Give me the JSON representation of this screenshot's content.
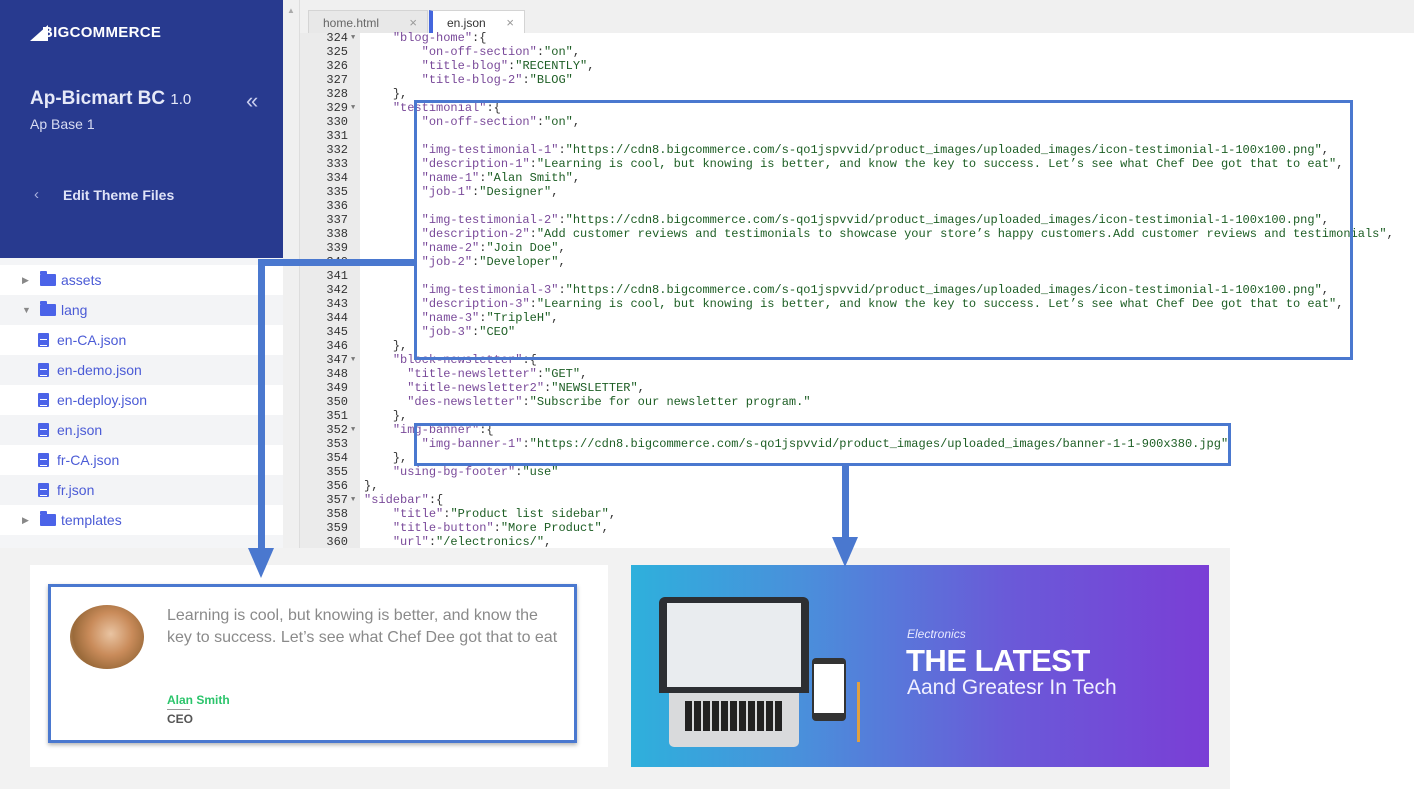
{
  "sidebar": {
    "logo": "BIGCOMMERCE",
    "theme_name": "Ap-Bicmart BC",
    "theme_version": "1.0",
    "theme_variant": "Ap Base 1",
    "collapse_icon": "«",
    "back_icon": "‹",
    "edit_label": "Edit Theme Files",
    "tree": [
      {
        "type": "folder",
        "label": "assets",
        "expanded": false
      },
      {
        "type": "folder",
        "label": "lang",
        "expanded": true
      },
      {
        "type": "file",
        "label": "en-CA.json"
      },
      {
        "type": "file",
        "label": "en-demo.json"
      },
      {
        "type": "file",
        "label": "en-deploy.json"
      },
      {
        "type": "file",
        "label": "en.json"
      },
      {
        "type": "file",
        "label": "fr-CA.json"
      },
      {
        "type": "file",
        "label": "fr.json"
      },
      {
        "type": "folder",
        "label": "templates",
        "expanded": false
      }
    ]
  },
  "editor": {
    "tabs": [
      {
        "label": "home.html",
        "active": false
      },
      {
        "label": "en.json",
        "active": true
      }
    ],
    "close_icon": "×",
    "lines": [
      {
        "n": "324",
        "i": 8,
        "k": "blog-home",
        "p": ":{",
        "f": true
      },
      {
        "n": "325",
        "i": 12,
        "k": "on-off-section",
        "v": "on",
        "p": ","
      },
      {
        "n": "326",
        "i": 12,
        "k": "title-blog",
        "v": "RECENTLY",
        "p": ","
      },
      {
        "n": "327",
        "i": 12,
        "k": "title-blog-2",
        "v": "BLOG"
      },
      {
        "n": "328",
        "i": 8,
        "p": "},"
      },
      {
        "n": "329",
        "i": 8,
        "k": "testimonial",
        "p": ":{",
        "f": true
      },
      {
        "n": "330",
        "i": 12,
        "k": "on-off-section",
        "v": "on",
        "p": ","
      },
      {
        "n": "331"
      },
      {
        "n": "332",
        "i": 12,
        "k": "img-testimonial-1",
        "v": "https://cdn8.bigcommerce.com/s-qo1jspvvid/product_images/uploaded_images/icon-testimonial-1-100x100.png",
        "p": ","
      },
      {
        "n": "333",
        "i": 12,
        "k": "description-1",
        "v": "Learning is cool, but knowing is better, and know the key to success. Let’s see what Chef Dee got that to eat",
        "p": ","
      },
      {
        "n": "334",
        "i": 12,
        "k": "name-1",
        "v": "Alan Smith",
        "p": ","
      },
      {
        "n": "335",
        "i": 12,
        "k": "job-1",
        "v": "Designer",
        "p": ","
      },
      {
        "n": "336"
      },
      {
        "n": "337",
        "i": 12,
        "k": "img-testimonial-2",
        "v": "https://cdn8.bigcommerce.com/s-qo1jspvvid/product_images/uploaded_images/icon-testimonial-1-100x100.png",
        "p": ","
      },
      {
        "n": "338",
        "i": 12,
        "k": "description-2",
        "v": "Add customer reviews and testimonials to showcase your store’s happy customers.Add customer reviews and testimonials",
        "p": ","
      },
      {
        "n": "339",
        "i": 12,
        "k": "name-2",
        "v": "Join Doe",
        "p": ","
      },
      {
        "n": "340",
        "i": 12,
        "k": "job-2",
        "v": "Developer",
        "p": ","
      },
      {
        "n": "341"
      },
      {
        "n": "342",
        "i": 12,
        "k": "img-testimonial-3",
        "v": "https://cdn8.bigcommerce.com/s-qo1jspvvid/product_images/uploaded_images/icon-testimonial-1-100x100.png",
        "p": ","
      },
      {
        "n": "343",
        "i": 12,
        "k": "description-3",
        "v": "Learning is cool, but knowing is better, and know the key to success. Let’s see what Chef Dee got that to eat",
        "p": ","
      },
      {
        "n": "344",
        "i": 12,
        "k": "name-3",
        "v": "TripleH",
        "p": ","
      },
      {
        "n": "345",
        "i": 12,
        "k": "job-3",
        "v": "CEO"
      },
      {
        "n": "346",
        "i": 8,
        "p": "},"
      },
      {
        "n": "347",
        "i": 8,
        "k": "block-newsletter",
        "p": ":{",
        "f": true
      },
      {
        "n": "348",
        "i": 10,
        "k": "title-newsletter",
        "v": "GET",
        "p": ","
      },
      {
        "n": "349",
        "i": 10,
        "k": "title-newsletter2",
        "v": "NEWSLETTER",
        "p": ","
      },
      {
        "n": "350",
        "i": 10,
        "k": "des-newsletter",
        "v": "Subscribe for our newsletter program."
      },
      {
        "n": "351",
        "i": 8,
        "p": "},"
      },
      {
        "n": "352",
        "i": 8,
        "k": "img-banner",
        "p": ":{",
        "f": true
      },
      {
        "n": "353",
        "i": 12,
        "k": "img-banner-1",
        "v": "https://cdn8.bigcommerce.com/s-qo1jspvvid/product_images/uploaded_images/banner-1-1-900x380.jpg"
      },
      {
        "n": "354",
        "i": 8,
        "p": "},"
      },
      {
        "n": "355",
        "i": 8,
        "k": "using-bg-footer",
        "v": "use"
      },
      {
        "n": "356",
        "i": 4,
        "p": "},"
      },
      {
        "n": "357",
        "i": 4,
        "k": "sidebar",
        "p": ":{",
        "f": true
      },
      {
        "n": "358",
        "i": 8,
        "k": "title",
        "v": "Product list sidebar",
        "p": ","
      },
      {
        "n": "359",
        "i": 8,
        "k": "title-button",
        "v": "More Product",
        "p": ","
      },
      {
        "n": "360",
        "i": 8,
        "k": "url",
        "v": "/electronics/",
        "p": ","
      }
    ]
  },
  "preview": {
    "testimonial": {
      "quote": "Learning is cool, but knowing is better, and know the key to success. Let’s see what Chef Dee got that to eat",
      "name": "Alan Smith",
      "job": "CEO"
    },
    "banner": {
      "category": "Electronics",
      "headline": "THE LATEST",
      "tagline": "Aand Greatesr In Tech"
    }
  },
  "colors": {
    "sidebar": "#283a8f",
    "highlight": "#4a78cf",
    "json_key": "#7a4a9a",
    "json_value": "#1d5e24",
    "testimonial_name": "#2bc46b"
  }
}
